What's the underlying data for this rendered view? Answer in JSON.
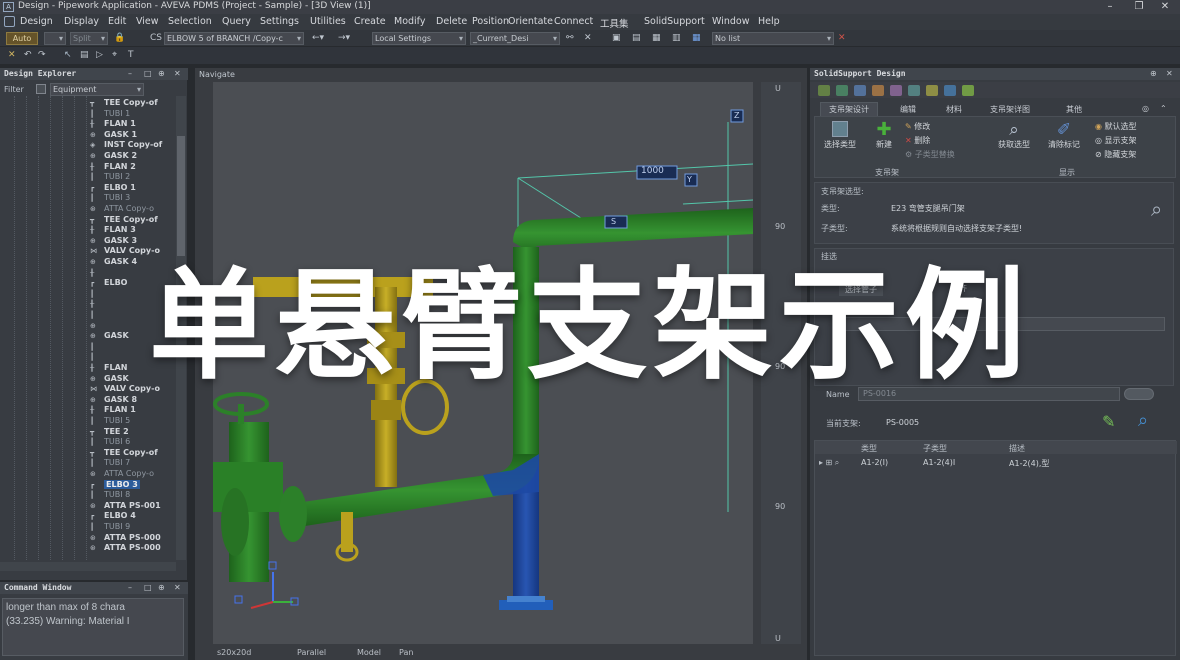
{
  "window": {
    "title": "Design - Pipework Application - AVEVA PDMS (Project - Sample) - [3D View (1)]",
    "app_icon": "A",
    "min": "–",
    "max": "❐",
    "close": "✕"
  },
  "menu": [
    "Design",
    "Display",
    "Edit",
    "View",
    "Selection",
    "Query",
    "Settings",
    "Utilities",
    "Create",
    "Modify",
    "Delete",
    "Position",
    "Orientate",
    "Connect",
    "工具集",
    "SolidSupport",
    "Window",
    "Help"
  ],
  "toolbar": {
    "auto_label": "Auto",
    "split_label": "Split",
    "cs_label": "CS",
    "element_combo": "ELBOW 5 of BRANCH /Copy-c",
    "settings_combo": "Local Settings",
    "design_combo": "_Current_Desi",
    "list_combo": "No list"
  },
  "design_explorer": {
    "title": "Design Explorer",
    "filter_label": "Filter",
    "filter_value": "Equipment",
    "items": [
      {
        "icon": "tee-icon",
        "label": "TEE Copy-of",
        "faded": false
      },
      {
        "icon": "tube-icon",
        "label": "TUBI 1",
        "faded": true
      },
      {
        "icon": "flange-icon",
        "label": "FLAN 1",
        "faded": false
      },
      {
        "icon": "gasket-icon",
        "label": "GASK 1",
        "faded": false
      },
      {
        "icon": "instrument-icon",
        "label": "INST Copy-of",
        "faded": false
      },
      {
        "icon": "gasket-icon",
        "label": "GASK 2",
        "faded": false
      },
      {
        "icon": "flange-icon",
        "label": "FLAN 2",
        "faded": false
      },
      {
        "icon": "tube-icon",
        "label": "TUBI 2",
        "faded": true
      },
      {
        "icon": "elbow-icon",
        "label": "ELBO 1",
        "faded": false
      },
      {
        "icon": "tube-icon",
        "label": "TUBI 3",
        "faded": true
      },
      {
        "icon": "attachment-icon",
        "label": "ATTA Copy-o",
        "faded": true
      },
      {
        "icon": "tee-icon",
        "label": "TEE Copy-of",
        "faded": false
      },
      {
        "icon": "flange-icon",
        "label": "FLAN 3",
        "faded": false
      },
      {
        "icon": "gasket-icon",
        "label": "GASK 3",
        "faded": false
      },
      {
        "icon": "valve-icon",
        "label": "VALV Copy-o",
        "faded": false
      },
      {
        "icon": "gasket-icon",
        "label": "GASK 4",
        "faded": false
      },
      {
        "icon": "flange-icon",
        "label": "",
        "faded": false
      },
      {
        "icon": "elbow-icon",
        "label": "ELBO",
        "faded": false
      },
      {
        "icon": "tube-icon",
        "label": "",
        "faded": true
      },
      {
        "icon": "flange-icon",
        "label": "",
        "faded": false
      },
      {
        "icon": "tube-icon",
        "label": "",
        "faded": true
      },
      {
        "icon": "gasket-icon",
        "label": "",
        "faded": false
      },
      {
        "icon": "gasket-icon",
        "label": "GASK",
        "faded": false
      },
      {
        "icon": "tube-icon",
        "label": "",
        "faded": true
      },
      {
        "icon": "tube-icon",
        "label": "",
        "faded": true
      },
      {
        "icon": "flange-icon",
        "label": "FLAN",
        "faded": false
      },
      {
        "icon": "gasket-icon",
        "label": "GASK",
        "faded": false
      },
      {
        "icon": "valve-icon",
        "label": "VALV Copy-o",
        "faded": false
      },
      {
        "icon": "gasket-icon",
        "label": "GASK 8",
        "faded": false
      },
      {
        "icon": "flange-icon",
        "label": "FLAN 1",
        "faded": false
      },
      {
        "icon": "tube-icon",
        "label": "TUBI 5",
        "faded": true
      },
      {
        "icon": "tee-icon",
        "label": "TEE 2",
        "faded": false
      },
      {
        "icon": "tube-icon",
        "label": "TUBI 6",
        "faded": true
      },
      {
        "icon": "tee-icon",
        "label": "TEE Copy-of",
        "faded": false
      },
      {
        "icon": "tube-icon",
        "label": "TUBI 7",
        "faded": true
      },
      {
        "icon": "attachment-icon",
        "label": "ATTA Copy-o",
        "faded": true
      },
      {
        "icon": "elbow-icon",
        "label": "ELBO 3",
        "faded": false,
        "selected": true
      },
      {
        "icon": "tube-icon",
        "label": "TUBI 8",
        "faded": true
      },
      {
        "icon": "attachment-icon",
        "label": "ATTA PS-001",
        "faded": false
      },
      {
        "icon": "elbow-icon",
        "label": "ELBO 4",
        "faded": false
      },
      {
        "icon": "tube-icon",
        "label": "TUBI 9",
        "faded": true
      },
      {
        "icon": "attachment-icon",
        "label": "ATTA PS-000",
        "faded": false
      },
      {
        "icon": "attachment-icon",
        "label": "ATTA PS-000",
        "faded": false
      }
    ]
  },
  "command_window": {
    "title": "Command Window",
    "lines": [
      "longer than max of 8 chara",
      "(33.235) Warning: Material I"
    ]
  },
  "viewport": {
    "title": "Navigate",
    "dimension": "1000",
    "axis_marks": [
      "Z",
      "Y",
      "S"
    ],
    "ruler": [
      "U",
      "90",
      "90",
      "90",
      "U"
    ],
    "status": [
      "s20x20d",
      "Parallel",
      "Model",
      "Pan"
    ]
  },
  "solid_support": {
    "title": "SolidSupport Design",
    "tabs": [
      "支吊架设计",
      "编辑",
      "材料",
      "支吊架详图",
      "其他"
    ],
    "buttons": {
      "select_type": "选择类型",
      "new": "新建",
      "modify": "修改",
      "delete": "删除",
      "subtype_replace": "子类型替换",
      "get_type": "获取选型",
      "clear_mark": "清除标记",
      "default_select": "默认选型",
      "show_support": "显示支架",
      "hide_support": "隐藏支架"
    },
    "groups": [
      "支吊架",
      "显示"
    ],
    "info_title": "支吊架选型:",
    "type_label": "类型:",
    "type_value": "E23  弯管支腿吊门架",
    "subtype_label": "子类型:",
    "subtype_value": "系统将根据规则自动选择支架子类型!",
    "mid_title": "挂选",
    "subtabs": [
      "选择管子",
      "对齐"
    ],
    "name_label": "Name",
    "name_value": "PS-0016",
    "current_label": "当前支架:",
    "current_value": "PS-0005",
    "table": {
      "headers": [
        "类型",
        "子类型",
        "描述"
      ],
      "rows": [
        [
          "A1-2(I)",
          "A1-2(4)I",
          "A1-2(4),型"
        ]
      ]
    }
  },
  "headline": "单悬臂支架示例",
  "colors": {
    "pipe_green": "#2f8a2c",
    "pipe_yellow": "#c9ae1f",
    "pipe_blue": "#1e4aa8",
    "selection": "#2f63a8"
  }
}
